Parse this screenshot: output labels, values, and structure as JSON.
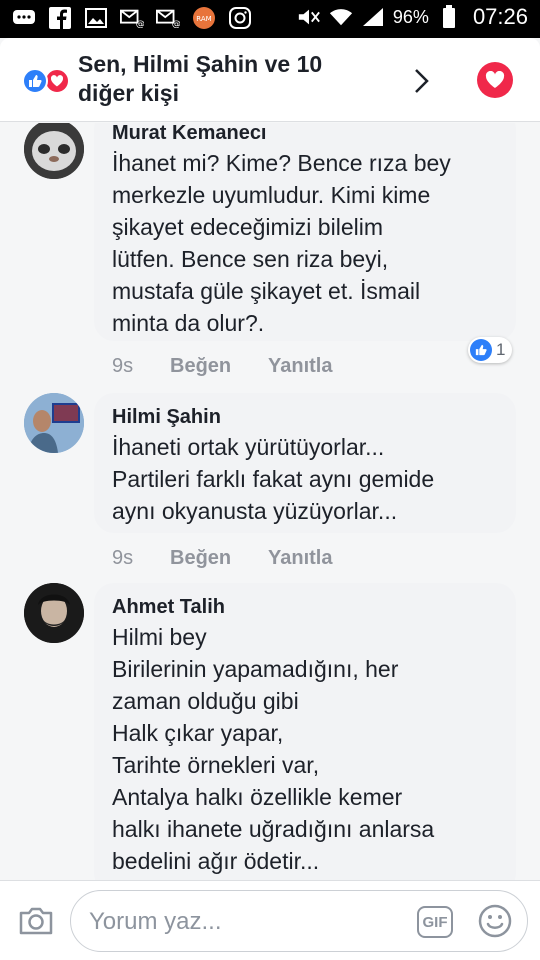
{
  "status_bar": {
    "battery_percent": "96%",
    "time": "07:26",
    "icons": [
      "message-icon",
      "facebook-icon",
      "gallery-icon",
      "email-icon",
      "email-icon",
      "ram-icon",
      "instagram-icon",
      "mute-icon",
      "wifi-icon",
      "signal-icon",
      "battery-icon"
    ]
  },
  "header": {
    "title": "Sen, Hilmi Şahin ve 10 diğer kişi"
  },
  "comments": [
    {
      "author": "Murat Kemanecı",
      "lines": [
        "İhanet mi? Kime? Bence rıza bey",
        "merkezle uyumludur. Kimi kime",
        "şikayet edeceğimizi bilelim",
        "lütfen.  Bence sen riza beyi,",
        "mustafa güle şikayet et.  İsmail",
        "minta da olur?."
      ],
      "time": "9s",
      "like_label": "Beğen",
      "reply_label": "Yanıtla",
      "reaction_count": "1"
    },
    {
      "author": "Hilmi Şahin",
      "lines": [
        "İhaneti ortak yürütüyorlar...",
        "Partileri farklı fakat aynı gemide",
        "aynı okyanusta yüzüyorlar..."
      ],
      "time": "9s",
      "like_label": "Beğen",
      "reply_label": "Yanıtla"
    },
    {
      "author": "Ahmet Talih",
      "lines": [
        "Hilmi bey",
        "Birilerinin yapamadığını, her",
        "zaman olduğu gibi",
        "Halk çıkar yapar,",
        "Tarihte örnekleri var,",
        "Antalya halkı özellikle kemer",
        "halkı ihanete uğradığını anlarsa",
        "bedelini ağır ödetir..."
      ]
    }
  ],
  "composer": {
    "placeholder": "Yorum yaz...",
    "gif_label": "GIF"
  },
  "colors": {
    "like_blue": "#2d7ff9",
    "love_red": "#f0284a",
    "bubble_bg": "#f2f3f5"
  }
}
